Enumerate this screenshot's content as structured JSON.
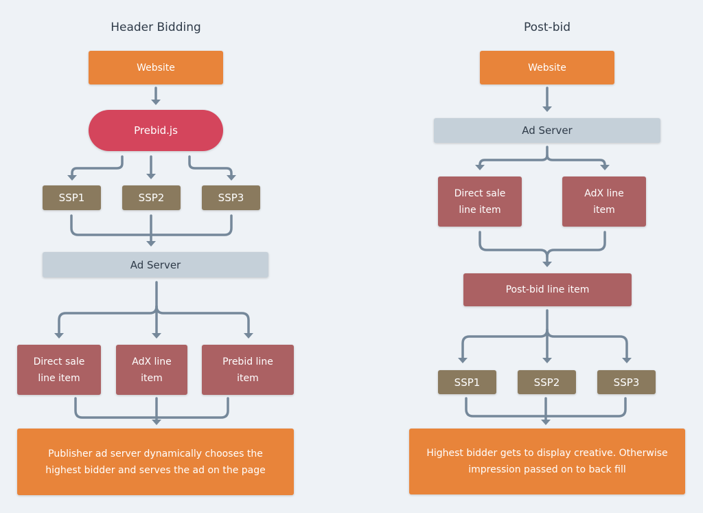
{
  "colors": {
    "background": "#EEF2F6",
    "website": "#E8843A",
    "prebid": "#D4455C",
    "ssp": "#8A7A5E",
    "line_item": "#AB6163",
    "ad_server": "#C5D0D9",
    "connector": "#75889A",
    "title_text": "#2E3A48"
  },
  "header_bidding": {
    "title": "Header Bidding",
    "website": "Website",
    "prebid": "Prebid.js",
    "ssps": [
      "SSP1",
      "SSP2",
      "SSP3"
    ],
    "ad_server": "Ad Server",
    "line_items": [
      "Direct sale line item",
      "AdX line item",
      "Prebid line item"
    ],
    "result": "Publisher ad server dynamically chooses the highest bidder and serves the ad on the page"
  },
  "post_bid": {
    "title": "Post-bid",
    "website": "Website",
    "ad_server": "Ad Server",
    "line_items": [
      "Direct sale line item",
      "AdX line item"
    ],
    "post_bid_line_item": "Post-bid line item",
    "ssps": [
      "SSP1",
      "SSP2",
      "SSP3"
    ],
    "result": "Highest bidder gets to display creative. Otherwise impression passed on to back fill"
  }
}
